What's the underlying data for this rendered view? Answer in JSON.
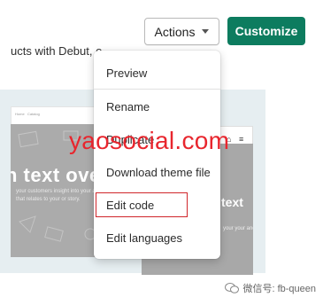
{
  "toolbar": {
    "actions_label": "Actions",
    "customize_label": "Customize"
  },
  "lead_text": "ucts with Debut, o",
  "preview": {
    "nav": [
      "Home",
      "Catalog"
    ],
    "hero_title": "h text over",
    "hero_body": "your customers insight into your and text that relates to your or story.",
    "mobile_title": "text",
    "mobile_body": "your your and"
  },
  "menu": {
    "items": [
      "Preview",
      "Rename",
      "Duplicate",
      "Download theme file",
      "Edit code",
      "Edit languages"
    ]
  },
  "watermark": "yaosocial.com",
  "wechat": {
    "label": "微信号: fb-queen"
  },
  "colors": {
    "primary": "#0d7c5f",
    "highlight": "#d0262b",
    "watermark": "#e8262e"
  }
}
